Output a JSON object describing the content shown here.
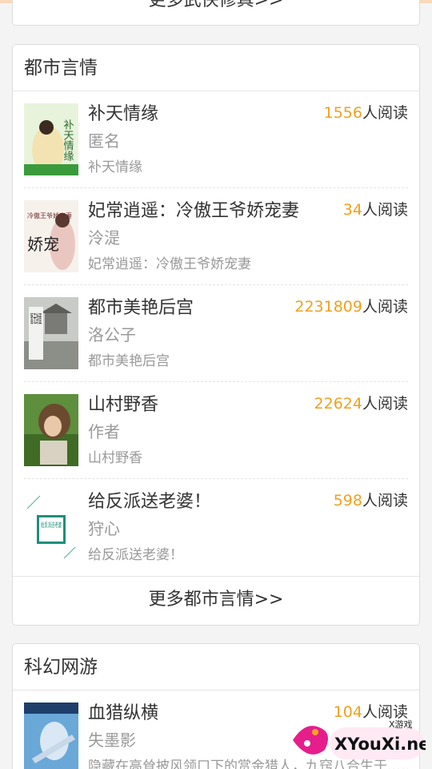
{
  "prev_section": {
    "more_label": "更多武侠修真>>"
  },
  "section1": {
    "title": "都市言情",
    "books": [
      {
        "title": "补天情缘",
        "author": "匿名",
        "desc": "补天情缘",
        "reads": "1556",
        "reads_suffix": "人阅读"
      },
      {
        "title": "妃常逍遥：冷傲王爷娇宠妻",
        "author": "泠湜",
        "desc": "妃常逍遥：冷傲王爷娇宠妻",
        "reads": "34",
        "reads_suffix": "人阅读"
      },
      {
        "title": "都市美艳后宫",
        "author": "洛公子",
        "desc": "都市美艳后宫",
        "reads": "2231809",
        "reads_suffix": "人阅读"
      },
      {
        "title": "山村野香",
        "author": "作者",
        "desc": "山村野香",
        "reads": "22624",
        "reads_suffix": "人阅读"
      },
      {
        "title": "给反派送老婆！",
        "author": "狩心",
        "desc": "给反派送老婆！",
        "reads": "598",
        "reads_suffix": "人阅读"
      }
    ],
    "more_label": "更多都市言情>>"
  },
  "section2": {
    "title": "科幻网游",
    "books": [
      {
        "title": "血猎纵横",
        "author": "失墨影",
        "desc": "隐藏在高耸披风领口下的赏金猎人，九窍八合生于……",
        "reads": "104",
        "reads_suffix": "人阅读"
      }
    ]
  },
  "covers": {
    "c1_text": "补天情缘",
    "c2_text": "冷傲王爷娇宠妻",
    "c3_text": "暂无封面",
    "c5_text": "给反派送老婆"
  },
  "watermark": {
    "small": "X游戏",
    "big": "XYouXi.net"
  },
  "colors": {
    "accent": "#f0a020",
    "muted": "#999999"
  }
}
